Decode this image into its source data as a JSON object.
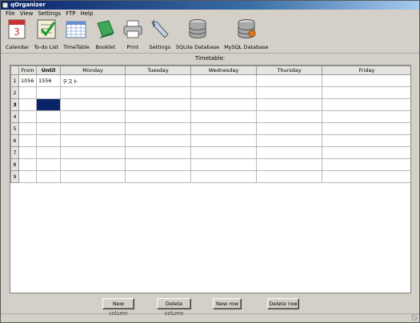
{
  "window": {
    "title": "qOrganizer"
  },
  "menu": [
    "File",
    "View",
    "Settings",
    "FTP",
    "Help"
  ],
  "toolbar": [
    {
      "label": "Calendar",
      "icon": "calendar-icon"
    },
    {
      "label": "To-do List",
      "icon": "todo-checklist-icon"
    },
    {
      "label": "TimeTable",
      "icon": "timetable-icon"
    },
    {
      "label": "Booklet",
      "icon": "booklet-icon"
    },
    {
      "label": "Print",
      "icon": "printer-icon"
    },
    {
      "label": "Settings",
      "icon": "wrench-icon"
    },
    {
      "label": "SQLite Database",
      "icon": "database-icon"
    },
    {
      "label": "MySQL Database",
      "icon": "mysql-database-icon"
    }
  ],
  "timetable": {
    "title": "Timetable:",
    "columns": [
      "From",
      "Until",
      "Monday",
      "Tuesday",
      "Wednesday",
      "Thursday",
      "Friday"
    ],
    "row_numbers": [
      "1",
      "2",
      "3",
      "4",
      "5",
      "6",
      "7",
      "8",
      "9"
    ],
    "rows": [
      [
        "1056",
        "1556",
        "テスト",
        "",
        "",
        "",
        ""
      ],
      [
        "",
        "",
        "",
        "",
        "",
        "",
        ""
      ],
      [
        "",
        "",
        "",
        "",
        "",
        "",
        ""
      ],
      [
        "",
        "",
        "",
        "",
        "",
        "",
        ""
      ],
      [
        "",
        "",
        "",
        "",
        "",
        "",
        ""
      ],
      [
        "",
        "",
        "",
        "",
        "",
        "",
        ""
      ],
      [
        "",
        "",
        "",
        "",
        "",
        "",
        ""
      ],
      [
        "",
        "",
        "",
        "",
        "",
        "",
        ""
      ],
      [
        "",
        "",
        "",
        "",
        "",
        "",
        ""
      ]
    ],
    "selected_row": 3,
    "selected_column": "Until"
  },
  "buttons": {
    "new_column": "New column",
    "delete_column": "Delete column",
    "new_row": "New row",
    "delete_row": "Delete row"
  }
}
